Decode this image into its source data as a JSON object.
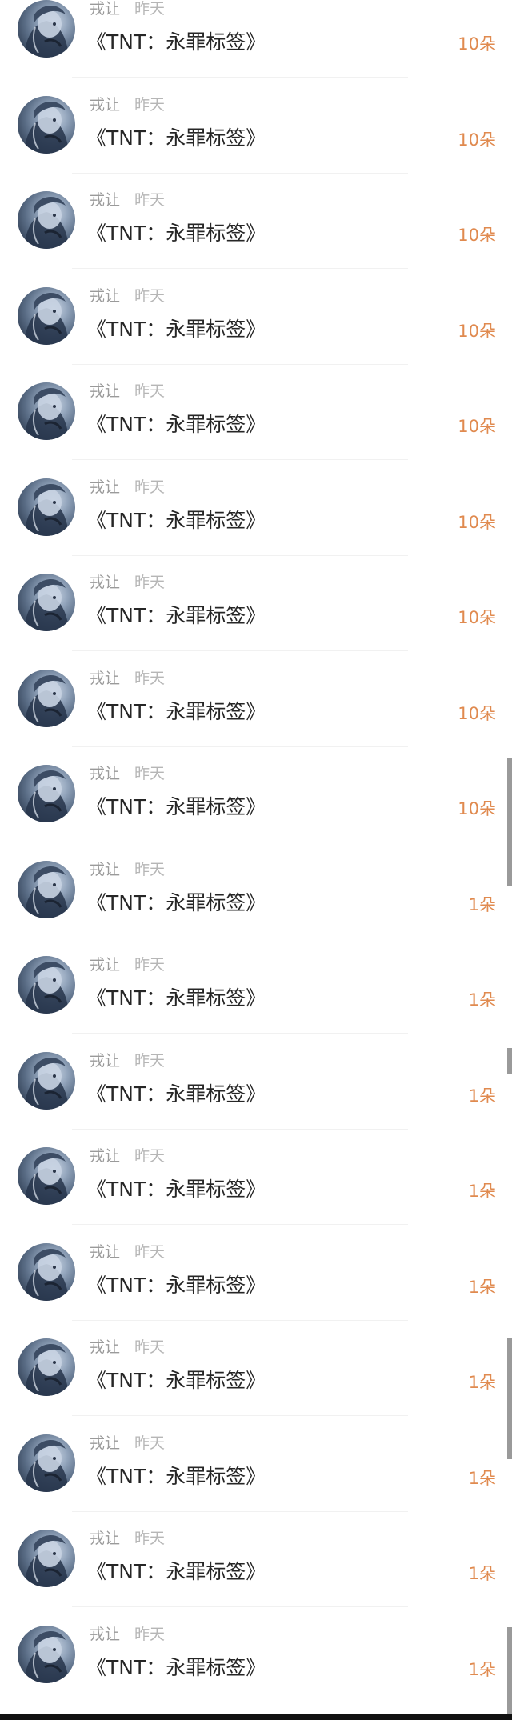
{
  "items": [
    {
      "name": "戎让",
      "time": "昨天",
      "title": "《TNT：永罪标签》",
      "amount": "10朵"
    },
    {
      "name": "戎让",
      "time": "昨天",
      "title": "《TNT：永罪标签》",
      "amount": "10朵"
    },
    {
      "name": "戎让",
      "time": "昨天",
      "title": "《TNT：永罪标签》",
      "amount": "10朵"
    },
    {
      "name": "戎让",
      "time": "昨天",
      "title": "《TNT：永罪标签》",
      "amount": "10朵"
    },
    {
      "name": "戎让",
      "time": "昨天",
      "title": "《TNT：永罪标签》",
      "amount": "10朵"
    },
    {
      "name": "戎让",
      "time": "昨天",
      "title": "《TNT：永罪标签》",
      "amount": "10朵"
    },
    {
      "name": "戎让",
      "time": "昨天",
      "title": "《TNT：永罪标签》",
      "amount": "10朵"
    },
    {
      "name": "戎让",
      "time": "昨天",
      "title": "《TNT：永罪标签》",
      "amount": "10朵"
    },
    {
      "name": "戎让",
      "time": "昨天",
      "title": "《TNT：永罪标签》",
      "amount": "10朵"
    },
    {
      "name": "戎让",
      "time": "昨天",
      "title": "《TNT：永罪标签》",
      "amount": "1朵"
    },
    {
      "name": "戎让",
      "time": "昨天",
      "title": "《TNT：永罪标签》",
      "amount": "1朵"
    },
    {
      "name": "戎让",
      "time": "昨天",
      "title": "《TNT：永罪标签》",
      "amount": "1朵"
    },
    {
      "name": "戎让",
      "time": "昨天",
      "title": "《TNT：永罪标签》",
      "amount": "1朵"
    },
    {
      "name": "戎让",
      "time": "昨天",
      "title": "《TNT：永罪标签》",
      "amount": "1朵"
    },
    {
      "name": "戎让",
      "time": "昨天",
      "title": "《TNT：永罪标签》",
      "amount": "1朵"
    },
    {
      "name": "戎让",
      "time": "昨天",
      "title": "《TNT：永罪标签》",
      "amount": "1朵"
    },
    {
      "name": "戎让",
      "time": "昨天",
      "title": "《TNT：永罪标签》",
      "amount": "1朵"
    },
    {
      "name": "戎让",
      "time": "昨天",
      "title": "《TNT：永罪标签》",
      "amount": "1朵"
    }
  ],
  "colors": {
    "amount": "#e08a4f",
    "name": "#9a9a9a",
    "time": "#b6b6b6",
    "title": "#262626"
  },
  "icons": {
    "avatar": "anime-character-avatar-icon"
  }
}
